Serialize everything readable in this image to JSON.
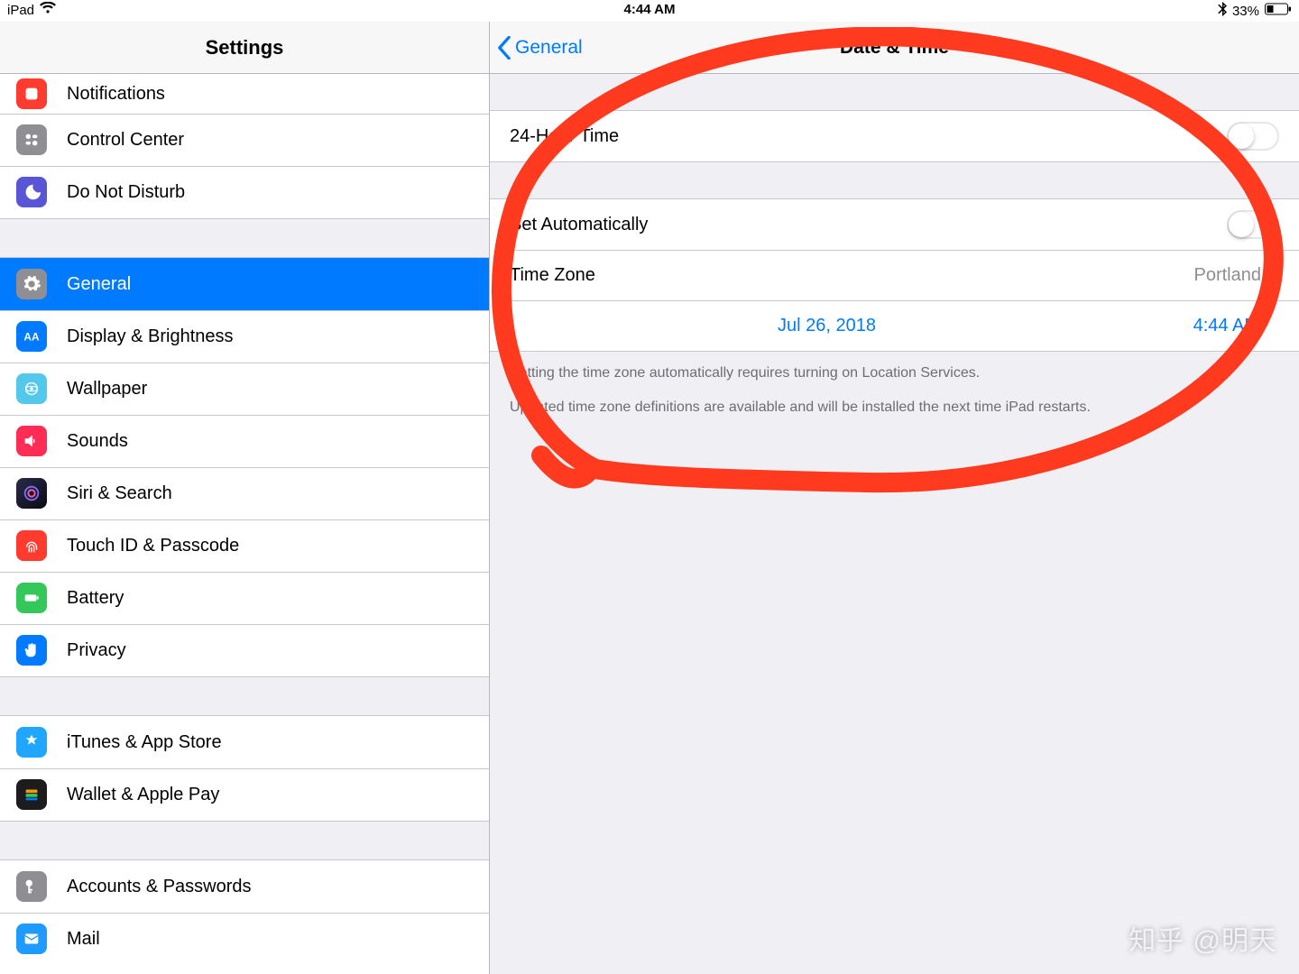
{
  "statusbar": {
    "device": "iPad",
    "time": "4:44 AM",
    "battery_text": "33%"
  },
  "left": {
    "title": "Settings",
    "group0": {
      "notifications": "Notifications",
      "control_center": "Control Center",
      "dnd": "Do Not Disturb"
    },
    "group1": {
      "general": "General",
      "display": "Display & Brightness",
      "wallpaper": "Wallpaper",
      "sounds": "Sounds",
      "siri": "Siri & Search",
      "touchid": "Touch ID & Passcode",
      "battery": "Battery",
      "privacy": "Privacy"
    },
    "group2": {
      "itunes": "iTunes & App Store",
      "wallet": "Wallet & Apple Pay"
    },
    "group3": {
      "accounts": "Accounts & Passwords",
      "mail": "Mail"
    }
  },
  "right": {
    "back_label": "General",
    "title": "Date & Time",
    "row_24h": "24-Hour Time",
    "row_auto": "Set Automatically",
    "row_tz": "Time Zone",
    "tz_value": "Portland",
    "date_value": "Jul 26, 2018",
    "time_value": "4:44 AM",
    "footer1": "Setting the time zone automatically requires turning on Location Services.",
    "footer2": "Updated time zone definitions are available and will be installed the next time iPad restarts."
  },
  "watermark": "知乎 @明天",
  "colors": {
    "notifications": "#ff3b30",
    "control_center": "#8e8e93",
    "dnd": "#5856d6",
    "general": "#8e8e93",
    "display": "#007aff",
    "wallpaper": "#54c7ec",
    "sounds": "#ff2d55",
    "siri": "#1c1c1e",
    "touchid": "#ff3b30",
    "battery": "#34c759",
    "privacy": "#007aff",
    "itunes": "#1fa7ff",
    "wallet": "#1c1c1e",
    "accounts": "#8e8e93",
    "mail": "#1f9bff"
  }
}
